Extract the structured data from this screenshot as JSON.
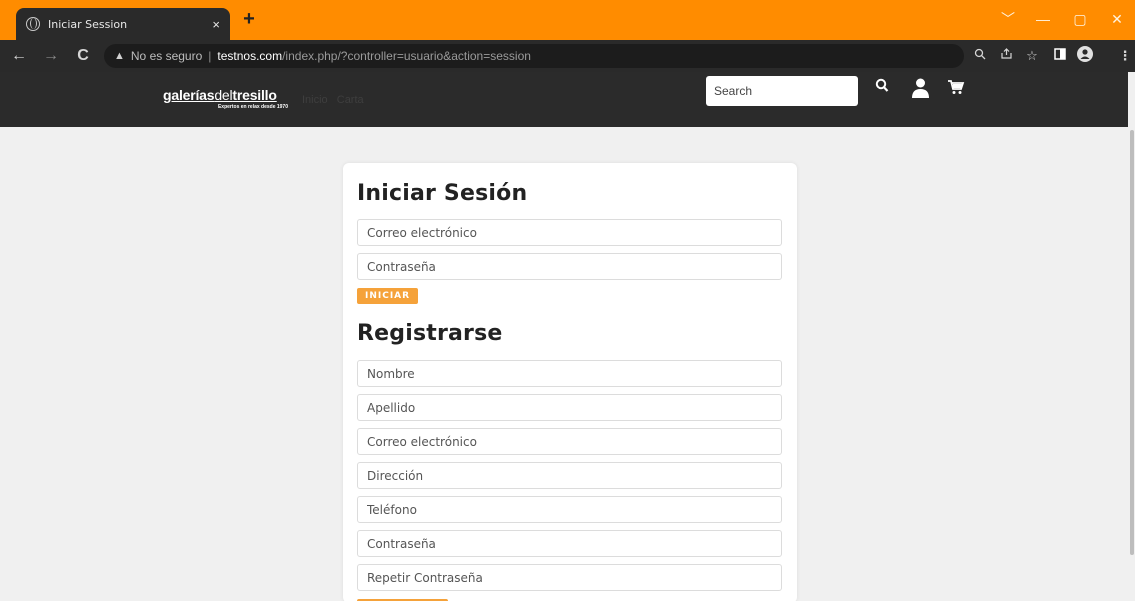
{
  "browser": {
    "tab_title": "Iniciar Session",
    "tab_close": "×",
    "new_tab": "+",
    "window_controls": [
      "﹀",
      "—",
      "▢",
      "✕"
    ],
    "omnibox": {
      "security_icon": "warning-icon",
      "security_text": "No es seguro",
      "host": "testnos.com",
      "path": "/index.php/?controller=usuario&action=session"
    },
    "nav": {
      "back": "←",
      "forward": "→",
      "reload": "C"
    },
    "icons": [
      "zoom-icon",
      "share-icon",
      "bookmark-star-icon",
      "side-panel-icon",
      "profile-icon",
      "menu-icon"
    ]
  },
  "site": {
    "logo": {
      "brand_bold": "galerías",
      "brand_light": "del",
      "brand_bold2": "tresillo",
      "tagline": "Expertos en relax desde 1970"
    },
    "nav_links": [
      "Inicio",
      "Carta"
    ],
    "search_placeholder": "Search",
    "header_icons": [
      "search-icon",
      "user-icon",
      "cart-icon"
    ]
  },
  "login": {
    "title": "Iniciar Sesión",
    "email_placeholder": "Correo electrónico",
    "password_placeholder": "Contraseña",
    "submit_label": "INICIAR"
  },
  "register": {
    "title": "Registrarse",
    "fields": [
      "Nombre",
      "Apellido",
      "Correo electrónico",
      "Dirección",
      "Teléfono",
      "Contraseña",
      "Repetir Contraseña"
    ]
  },
  "colors": {
    "titlebar": "#ff8c00",
    "chrome_dark": "#2a2a2a",
    "header": "#2b2b2b",
    "accent_button": "#f5a23a"
  }
}
